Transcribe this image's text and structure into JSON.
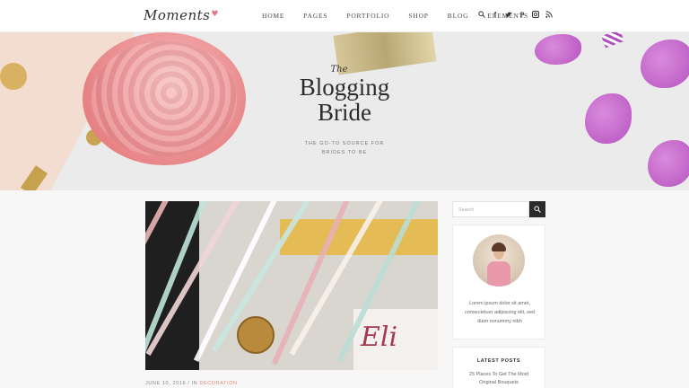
{
  "header": {
    "logo_text": "Moments",
    "logo_mark": "♥",
    "nav": [
      "HOME",
      "PAGES",
      "PORTFOLIO",
      "SHOP",
      "BLOG",
      "ELEMENTS"
    ],
    "social_icons": [
      "search-icon",
      "facebook-icon",
      "twitter-icon",
      "pinterest-icon",
      "instagram-icon",
      "rss-icon"
    ]
  },
  "hero": {
    "the": "The",
    "title_line1": "Blogging",
    "title_line2": "Bride",
    "tagline_line1": "THE GO-TO SOURCE FOR",
    "tagline_line2": "BRIDES TO BE"
  },
  "post": {
    "date": "JUNE 10, 2016",
    "separator": " / IN ",
    "category": "DECORATION"
  },
  "sidebar": {
    "search_placeholder": "Search",
    "about_line1": "Lorem ipsum dolor sit amet,",
    "about_line2": "consectetuer adipiscing elit, sed",
    "about_line3": "diam nonummy nibh",
    "latest_heading": "LATEST POSTS",
    "latest_item_line1": "25 Places To Get The Most",
    "latest_item_line2": "Original Bouquets"
  },
  "colors": {
    "accent": "#e18b7b",
    "dark": "#2b2b2b",
    "petal": "#b653c0"
  }
}
